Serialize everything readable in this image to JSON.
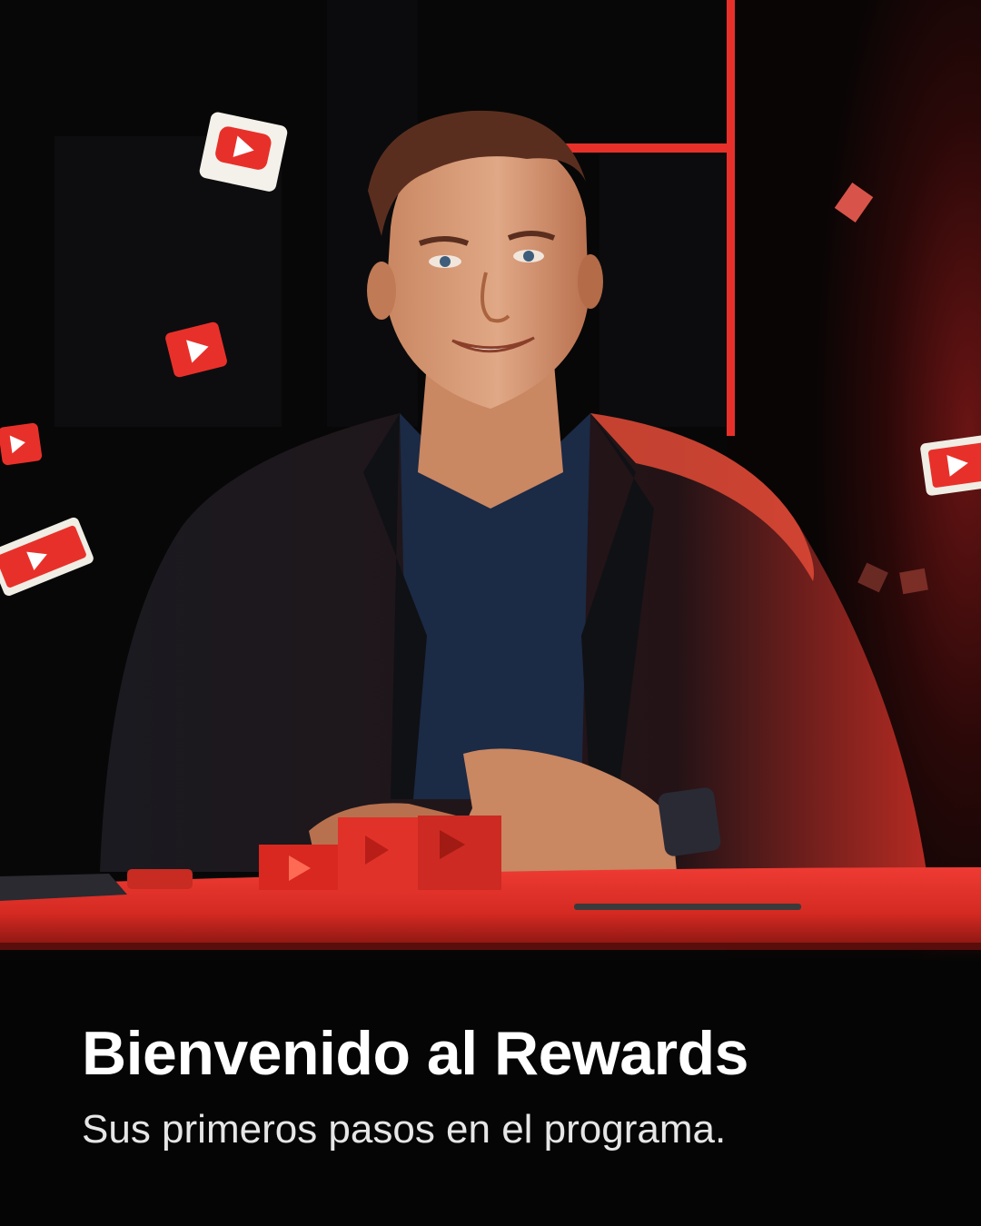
{
  "welcome": {
    "title": "Bienvenido al Rewards",
    "subtitle": "Sus primeros pasos en el programa."
  },
  "illustration": {
    "subject": "man-in-suit-at-desk",
    "icon": "play-button-icon",
    "colors": {
      "background": "#050505",
      "accent_red": "#e8302a",
      "desk_red": "#d8281f",
      "suit": "#15161c",
      "shirt": "#1b2a45",
      "skin": "#d9a07a"
    }
  }
}
